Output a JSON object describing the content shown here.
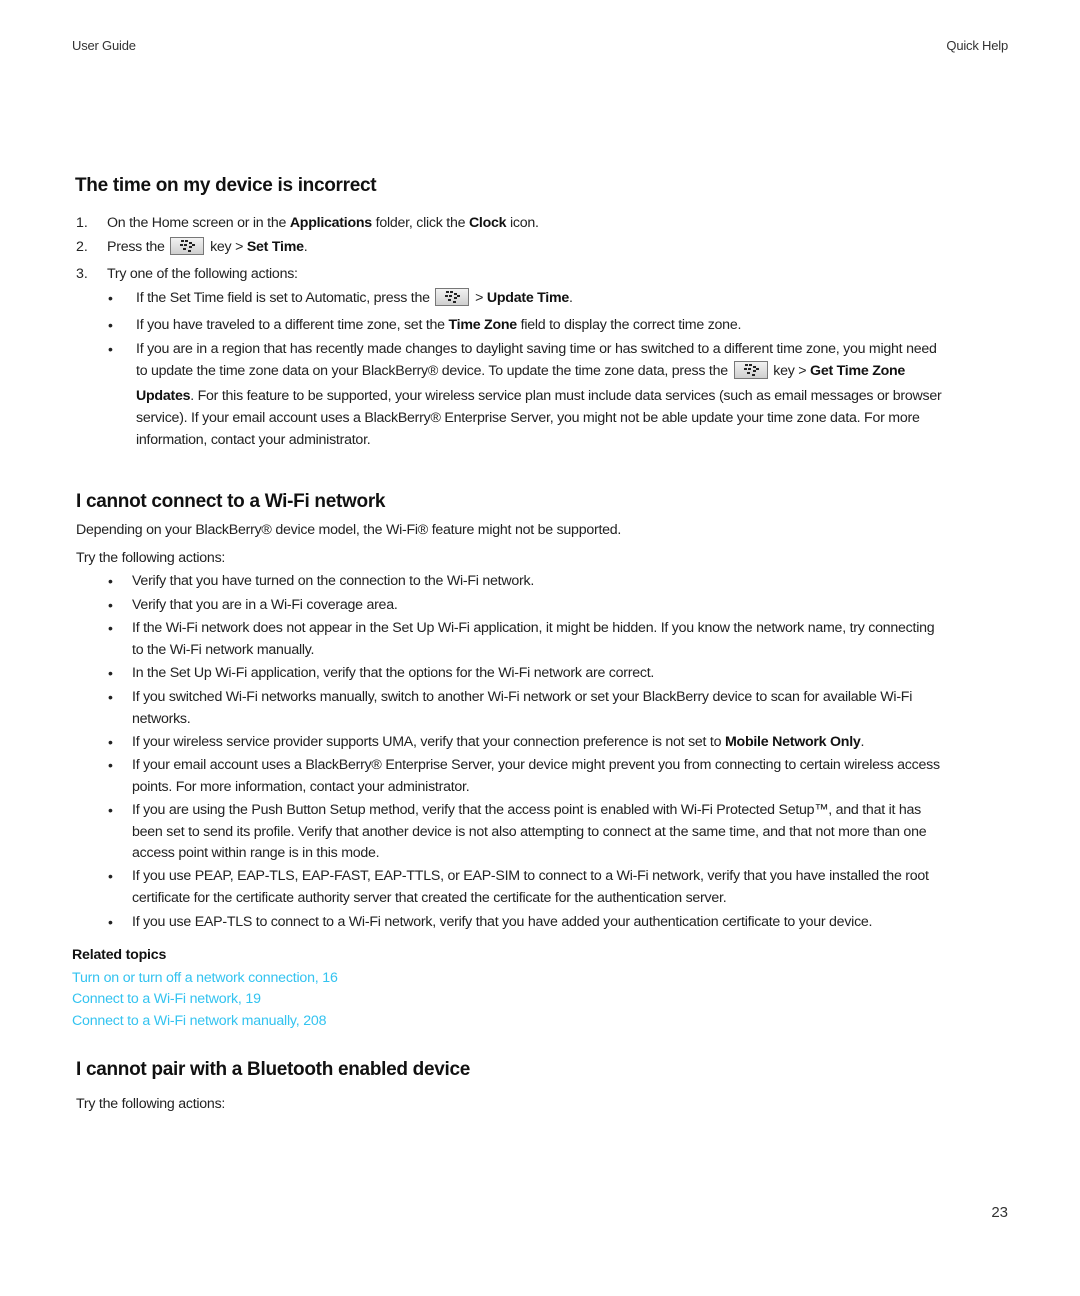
{
  "header": {
    "left": "User Guide",
    "right": "Quick Help"
  },
  "page_number": "23",
  "section1": {
    "title": "The time on my device is incorrect",
    "steps": [
      {
        "num": "1.",
        "pre": "On the Home screen or in the ",
        "b1": "Applications",
        "mid": " folder, click the ",
        "b2": "Clock",
        "post": " icon."
      },
      {
        "num": "2.",
        "pre": "Press the ",
        "post": " key > ",
        "b1": "Set Time",
        "end": "."
      },
      {
        "num": "3.",
        "text": "Try one of the following actions:"
      }
    ],
    "bullets": {
      "b1": {
        "pre": "If the Set Time field is set to Automatic, press the ",
        "post": " > ",
        "bold": "Update Time",
        "end": "."
      },
      "b2": {
        "pre": "If you have traveled to a different time zone, set the ",
        "bold": "Time Zone",
        "post": " field to display the correct time zone."
      },
      "b3": {
        "line1": "If you are in a region that has recently made changes to daylight saving time or has switched to a different time zone, you might need",
        "line2_pre": "to update the time zone data on your BlackBerry® device. To update the time zone data, press the ",
        "line2_post": " key > ",
        "line2_bold": "Get Time Zone",
        "line3_bold": "Updates",
        "line3": ". For this feature to be supported, your wireless service plan must include data services (such as email messages or browser",
        "line4": "service). If your email account uses a BlackBerry® Enterprise Server, you might not be able update your time zone data. For more",
        "line5": "information, contact your administrator."
      }
    },
    "key_icon": "blackberry-menu-key-icon"
  },
  "section2": {
    "title": "I cannot connect to a Wi-Fi network",
    "intro": "Depending on your BlackBerry® device model, the Wi-Fi® feature might not be supported.",
    "try": "Try the following actions:",
    "bullets": [
      {
        "lines": [
          "Verify that you have turned on the connection to the Wi-Fi network."
        ]
      },
      {
        "lines": [
          "Verify that you are in a Wi-Fi coverage area."
        ]
      },
      {
        "lines": [
          "If the Wi-Fi network does not appear in the Set Up Wi-Fi application, it might be hidden. If you know the network name, try connecting",
          "to the Wi-Fi network manually."
        ]
      },
      {
        "lines": [
          "In the Set Up Wi-Fi application, verify that the options for the Wi-Fi network are correct."
        ]
      },
      {
        "lines": [
          "If you switched Wi-Fi networks manually, switch to another Wi-Fi network or set your BlackBerry device to scan for available Wi-Fi",
          "networks."
        ]
      },
      {
        "pre": "If your wireless service provider supports UMA, verify that your connection preference is not set to ",
        "bold": "Mobile Network Only",
        "end": "."
      },
      {
        "lines": [
          "If your email account uses a BlackBerry® Enterprise Server, your device might prevent you from connecting to certain wireless access",
          "points. For more information, contact your administrator."
        ]
      },
      {
        "lines": [
          "If you are using the Push Button Setup method, verify that the access point is enabled with Wi-Fi Protected Setup™, and that it has",
          "been set to send its profile. Verify that another device is not also attempting to connect at the same time, and that not more than one",
          "access point within range is in this mode."
        ]
      },
      {
        "lines": [
          "If you use PEAP, EAP-TLS, EAP-FAST, EAP-TTLS, or EAP-SIM to connect to a Wi-Fi network, verify that you have installed the root",
          "certificate for the certificate authority server that created the certificate for the authentication server."
        ]
      },
      {
        "lines": [
          "If you use EAP-TLS to connect to a Wi-Fi network, verify that you have added your authentication certificate to your device."
        ]
      }
    ],
    "related_title": "Related topics",
    "related_links": [
      "Turn on or turn off a network connection, 16",
      "Connect to a Wi-Fi network, 19",
      "Connect to a Wi-Fi network manually, 208"
    ],
    "link_color": "#33c3f0"
  },
  "section3": {
    "title": "I cannot pair with a Bluetooth enabled device",
    "try": "Try the following actions:"
  }
}
